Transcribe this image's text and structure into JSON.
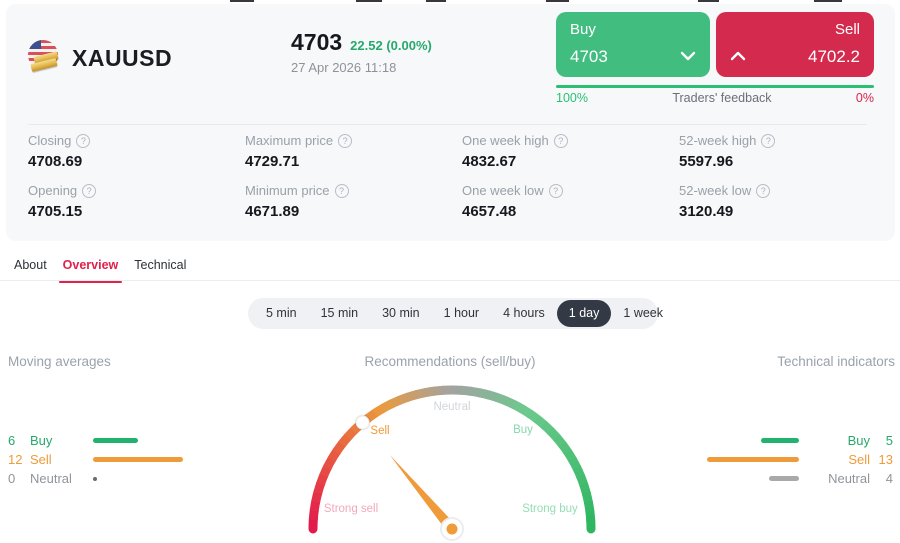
{
  "header": {
    "symbol": "XAUUSD",
    "price": "4703",
    "change": "22.52 (0.00%)",
    "datetime": "27 Apr 2026 11:18",
    "buy_button": {
      "label": "Buy",
      "price": "4703"
    },
    "sell_button": {
      "label": "Sell",
      "price": "4702.2"
    },
    "feedback": {
      "label": "Traders' feedback",
      "buy_pct": "100%",
      "sell_pct": "0%"
    }
  },
  "stats": [
    {
      "label": "Closing",
      "value": "4708.69"
    },
    {
      "label": "Maximum price",
      "value": "4729.71"
    },
    {
      "label": "One week high",
      "value": "4832.67"
    },
    {
      "label": "52-week high",
      "value": "5597.96"
    },
    {
      "label": "Opening",
      "value": "4705.15"
    },
    {
      "label": "Minimum price",
      "value": "4671.89"
    },
    {
      "label": "One week low",
      "value": "4657.48"
    },
    {
      "label": "52-week low",
      "value": "3120.49"
    }
  ],
  "tabs": [
    {
      "label": "About",
      "active": false
    },
    {
      "label": "Overview",
      "active": true
    },
    {
      "label": "Technical",
      "active": false
    }
  ],
  "timeframes": [
    {
      "label": "5 min",
      "active": false
    },
    {
      "label": "15 min",
      "active": false
    },
    {
      "label": "30 min",
      "active": false
    },
    {
      "label": "1 hour",
      "active": false
    },
    {
      "label": "4 hours",
      "active": false
    },
    {
      "label": "1 day",
      "active": true
    },
    {
      "label": "1 week",
      "active": false
    }
  ],
  "sections": {
    "moving_averages": "Moving averages",
    "recommendations": "Recommendations (sell/buy)",
    "technical_indicators": "Technical indicators"
  },
  "moving_averages": {
    "rows": [
      {
        "count": 6,
        "label": "Buy",
        "type": "buy"
      },
      {
        "count": 12,
        "label": "Sell",
        "type": "sell"
      },
      {
        "count": 0,
        "label": "Neutral",
        "type": "neutral"
      }
    ]
  },
  "technical_indicators": {
    "rows": [
      {
        "count": 5,
        "label": "Buy",
        "type": "buy"
      },
      {
        "count": 13,
        "label": "Sell",
        "type": "sell"
      },
      {
        "count": 4,
        "label": "Neutral",
        "type": "neutral"
      }
    ]
  },
  "gauge": {
    "labels": [
      "Strong sell",
      "Sell",
      "Neutral",
      "Buy",
      "Strong buy"
    ],
    "needle_angle_deg": 130,
    "marker_angle_deg": 130,
    "needle_color": "#ef9b3a",
    "stops": [
      {
        "t": 0.0,
        "c": "#e2174d"
      },
      {
        "t": 0.18,
        "c": "#e85a41"
      },
      {
        "t": 0.33,
        "c": "#eb9a3e"
      },
      {
        "t": 0.5,
        "c": "#a2a2a2"
      },
      {
        "t": 0.68,
        "c": "#6cc98d"
      },
      {
        "t": 1.0,
        "c": "#2cb55e"
      }
    ]
  },
  "colors": {
    "buy_green": "#42bd80",
    "sell_red": "#d32a4e",
    "accent_crimson": "#e0224a",
    "text_green": "#26a96c",
    "text_orange": "#ef9b3a",
    "feedback_green": "#2bbf74",
    "active_pill_dark": "#333a45"
  },
  "icons": {
    "flag": "us-flag-gold-bars",
    "chevron_down": "v",
    "chevron_up": "^",
    "help": "?"
  }
}
